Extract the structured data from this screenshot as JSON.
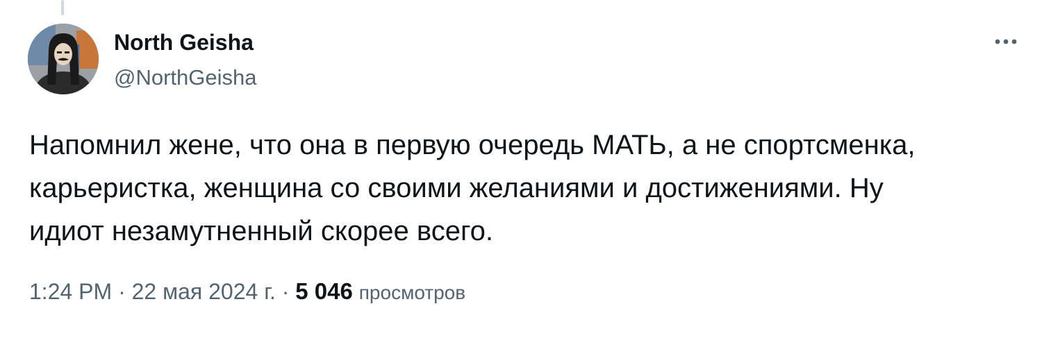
{
  "tweet": {
    "author": {
      "display_name": "North Geisha",
      "handle": "@NorthGeisha"
    },
    "text_lines": [
      "Напомнил жене, что она в первую очередь МАТЬ, а не спортсменка,",
      "карьеристка, женщина со своими желаниями и достижениями. Ну",
      "идиот незамутненный скорее всего."
    ],
    "time": "1:24 PM",
    "separator": "·",
    "date": "22 мая 2024 г.",
    "views_count": "5 046",
    "views_label": "просмотров"
  },
  "icons": {
    "avatar": "avatar-image",
    "more": "more-options-icon"
  },
  "colors": {
    "text_primary": "#0f1419",
    "text_secondary": "#536471",
    "thread_line": "#cfd9de",
    "background": "#ffffff"
  }
}
